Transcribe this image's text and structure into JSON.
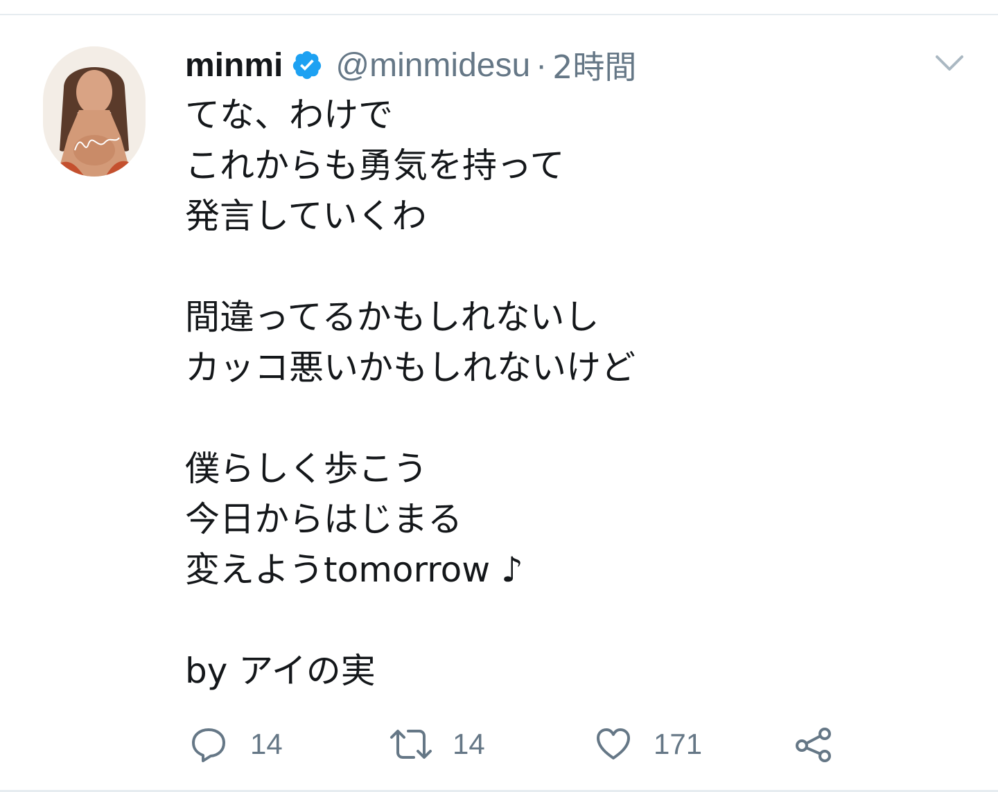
{
  "tweet": {
    "display_name": "minmi",
    "handle": "@minmidesu",
    "separator": "·",
    "time": "2時間",
    "lines": [
      "てな、わけで",
      "これからも勇気を持って",
      "発言していくわ",
      "",
      "間違ってるかもしれないし",
      "カッコ悪いかもしれないけど",
      "",
      "僕らしく歩こう",
      "今日からはじまる",
      "変えようtomorrow ♪",
      "",
      "by アイの実"
    ]
  },
  "actions": {
    "reply_count": "14",
    "retweet_count": "14",
    "like_count": "171"
  },
  "icons": {
    "avatar": "profile-photo",
    "verified": "verified-badge-icon",
    "more": "chevron-down-icon",
    "reply": "reply-bubble-icon",
    "retweet": "retweet-icon",
    "like": "heart-icon",
    "share": "share-icon"
  },
  "colors": {
    "text": "#14171a",
    "secondary": "#657786",
    "verified_blue": "#1da1f2",
    "divider": "#e6ecf0"
  }
}
